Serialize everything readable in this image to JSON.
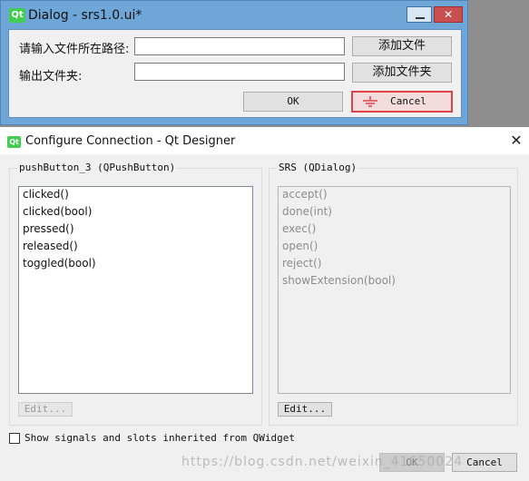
{
  "top_dialog": {
    "logo_text": "Qt",
    "title": "Dialog - srs1.0.ui*",
    "path_label": "请输入文件所在路径:",
    "path_value": "",
    "add_file_label": "添加文件",
    "output_label": "输出文件夹:",
    "output_value": "",
    "add_folder_label": "添加文件夹",
    "ok_label": "OK",
    "cancel_label": "Cancel"
  },
  "connection_dialog": {
    "logo_text": "Qt",
    "title": "Configure Connection - Qt Designer",
    "sender_group": "pushButton_3 (QPushButton)",
    "signals": [
      "clicked()",
      "clicked(bool)",
      "pressed()",
      "released()",
      "toggled(bool)"
    ],
    "sender_edit_label": "Edit...",
    "receiver_group": "SRS (QDialog)",
    "slots": [
      "accept()",
      "done(int)",
      "exec()",
      "open()",
      "reject()",
      "showExtension(bool)"
    ],
    "receiver_edit_label": "Edit...",
    "inherited_checkbox_label": "Show signals and slots inherited from QWidget",
    "inherited_checked": false,
    "ok_label": "OK",
    "cancel_label": "Cancel"
  },
  "watermark": "https://blog.csdn.net/weixin_41650024",
  "colors": {
    "titlebar_blue": "#6fa6d8",
    "close_red": "#c95050",
    "selection_red": "#e0424a",
    "qt_green": "#41cd52"
  }
}
